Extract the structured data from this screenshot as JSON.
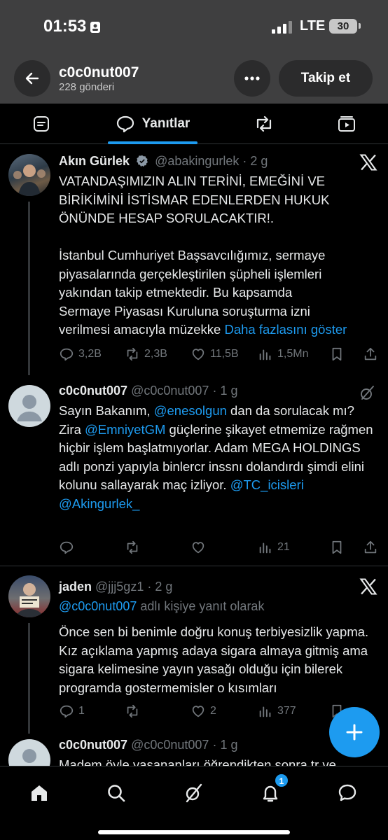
{
  "status": {
    "time": "01:53",
    "network": "LTE",
    "battery": "30"
  },
  "header": {
    "profile_name": "c0c0nut007",
    "post_count": "228 gönderi",
    "follow_label": "Takip et"
  },
  "tabs": {
    "active_label": "Yanıtlar"
  },
  "posts": [
    {
      "name": "Akın Gürlek",
      "handle": "@abakingurlek",
      "time": "· 2 g",
      "verified": true,
      "lines": [
        "VATANDAŞIMIZIN ALIN TERİNİ, EMEĞİNİ VE",
        "BİRİKİMİNİ İSTİSMAR EDENLERDEN HUKUK",
        "ÖNÜNDE HESAP SORULACAKTIR!.",
        "",
        "İstanbul Cumhuriyet Başsavcılığımız, sermaye",
        "piyasalarında gerçekleştirilen şüpheli işlemleri",
        "yakından takip etmektedir. Bu kapsamda",
        "Sermaye Piyasası Kuruluna soruşturma izni",
        "verilmesi amacıyla müzekke"
      ],
      "show_more": "Daha fazlasını göster",
      "replies": "3,2B",
      "reposts": "2,3B",
      "likes": "11,5B",
      "views": "1,5Mn"
    },
    {
      "name": "c0c0nut007",
      "handle": "@c0c0nut007",
      "time": "· 1 g",
      "segments": [
        {
          "t": "Sayın Bakanım, ",
          "link": false
        },
        {
          "t": "@enesolgun",
          "link": true
        },
        {
          "t": " dan da sorulacak mı? Zira ",
          "link": false
        },
        {
          "t": "@EmniyetGM",
          "link": true
        },
        {
          "t": " güçlerine şikayet etmemize rağmen hiçbir işlem başlatmıyorlar. Adam MEGA HOLDINGS adlı ponzi yapıyla binlercr inssnı dolandırdı şimdi elini kolunu sallayarak maç izliyor. ",
          "link": false
        },
        {
          "t": "@TC_icisleri",
          "link": true
        },
        {
          "t": " ",
          "link": false
        },
        {
          "t": "@Akingurlek_",
          "link": true
        }
      ],
      "views": "21"
    },
    {
      "name": "jaden",
      "handle": "@jjj5gz1",
      "time": "· 2 g",
      "reply_to_handle": "@c0c0nut007",
      "reply_to_text": " adlı kişiye yanıt olarak",
      "body": "Önce sen bi benimle doğru konuş terbiyesizlik yapma. Kız açıklama yapmış adaya sigara almaya gitmiş ama sigara kelimesine yayın yasağı olduğu için bilerek programda gostermemisler o kısımları",
      "replies": "1",
      "likes": "2",
      "views": "377"
    },
    {
      "name": "c0c0nut007",
      "handle": "@c0c0nut007",
      "time": "· 1 g",
      "body": "Madem öyle yasananları öğrendikten sonra tr ve"
    }
  ],
  "nav": {
    "notifications_badge": "1"
  },
  "colors": {
    "accent": "#1d9bf0",
    "background": "#000000",
    "header": "#3f3f40",
    "muted": "#71767b"
  },
  "icons": [
    "back-arrow-icon",
    "more-icon",
    "posts-tab-icon",
    "replies-tab-icon",
    "reposts-tab-icon",
    "media-tab-icon",
    "verified-icon",
    "x-logo-icon",
    "reply-icon",
    "repost-icon",
    "like-icon",
    "views-icon",
    "bookmark-icon",
    "share-icon",
    "grok-icon",
    "home-icon",
    "search-icon",
    "notifications-icon",
    "messages-icon",
    "compose-icon"
  ]
}
